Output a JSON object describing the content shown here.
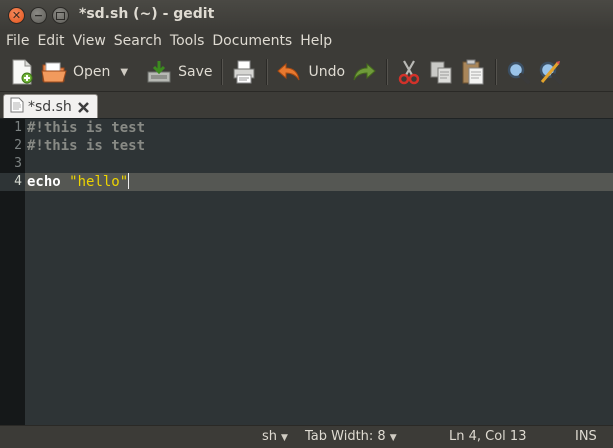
{
  "window": {
    "title": "*sd.sh (~) - gedit"
  },
  "menu": [
    "File",
    "Edit",
    "View",
    "Search",
    "Tools",
    "Documents",
    "Help"
  ],
  "toolbar": {
    "open_label": "Open",
    "save_label": "Save",
    "undo_label": "Undo",
    "icons": [
      "new-document-icon",
      "open-folder-icon",
      "save-icon",
      "print-icon",
      "undo-icon",
      "redo-icon",
      "cut-icon",
      "copy-icon",
      "paste-icon",
      "find-icon",
      "find-replace-icon"
    ]
  },
  "tabs": [
    {
      "label": "*sd.sh"
    }
  ],
  "editor": {
    "line_numbers": [
      "1",
      "2",
      "3",
      "4"
    ],
    "lines": {
      "l1": "#!this is test",
      "l2": "#!this is test",
      "l3": "",
      "l4_keyword": "echo",
      "l4_string": "\"hello\""
    },
    "current_line": 4
  },
  "statusbar": {
    "language": "sh",
    "tab_width": "Tab Width: 8",
    "position": "Ln 4, Col 13",
    "mode": "INS"
  },
  "colors": {
    "editor_bg": "#2e3436",
    "gutter_bg": "#151819",
    "current_line": "#555753",
    "string": "#edd400",
    "comment": "#888a85",
    "chrome": "#3c3b37"
  }
}
